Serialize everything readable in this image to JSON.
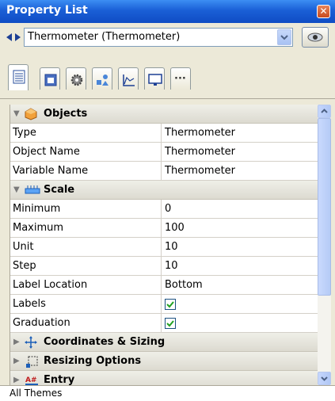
{
  "window": {
    "title": "Property List",
    "close_glyph": "✕"
  },
  "object_selector": {
    "value": "Thermometer (Thermometer)",
    "prev_icon": "left-arrow-icon",
    "next_icon": "right-arrow-icon",
    "view_icon": "eye-icon"
  },
  "tabs": [
    {
      "icon": "property-list-icon",
      "active": true
    },
    {
      "icon": "window-icon",
      "active": false
    },
    {
      "icon": "gear-icon",
      "active": false
    },
    {
      "icon": "shapes-icon",
      "active": false
    },
    {
      "icon": "chart-icon",
      "active": false
    },
    {
      "icon": "monitor-icon",
      "active": false
    },
    {
      "icon": "ellipsis-icon",
      "active": false,
      "label": "···"
    }
  ],
  "categories": {
    "objects": {
      "label": "Objects",
      "icon": "cube-icon",
      "expanded": true
    },
    "scale": {
      "label": "Scale",
      "icon": "ruler-icon",
      "expanded": true
    },
    "coordinates": {
      "label": "Coordinates & Sizing",
      "icon": "move-arrows-icon",
      "expanded": false
    },
    "resizing": {
      "label": "Resizing Options",
      "icon": "resize-icon",
      "expanded": false
    },
    "entry": {
      "label": "Entry",
      "icon": "entry-icon",
      "expanded": false
    }
  },
  "objects_rows": [
    {
      "key": "Type",
      "value": "Thermometer"
    },
    {
      "key": "Object Name",
      "value": "Thermometer"
    },
    {
      "key": "Variable Name",
      "value": "Thermometer"
    }
  ],
  "scale_rows": [
    {
      "key": "Minimum",
      "value": "0"
    },
    {
      "key": "Maximum",
      "value": "100"
    },
    {
      "key": "Unit",
      "value": "10"
    },
    {
      "key": "Step",
      "value": "10"
    },
    {
      "key": "Label Location",
      "value": "Bottom"
    },
    {
      "key": "Labels",
      "checked": true
    },
    {
      "key": "Graduation",
      "checked": true
    }
  ],
  "status": {
    "text": "All Themes"
  },
  "colors": {
    "title_bar": "#1a5fd6",
    "category_bg": "#e4e2d8",
    "check": "#21a121"
  }
}
